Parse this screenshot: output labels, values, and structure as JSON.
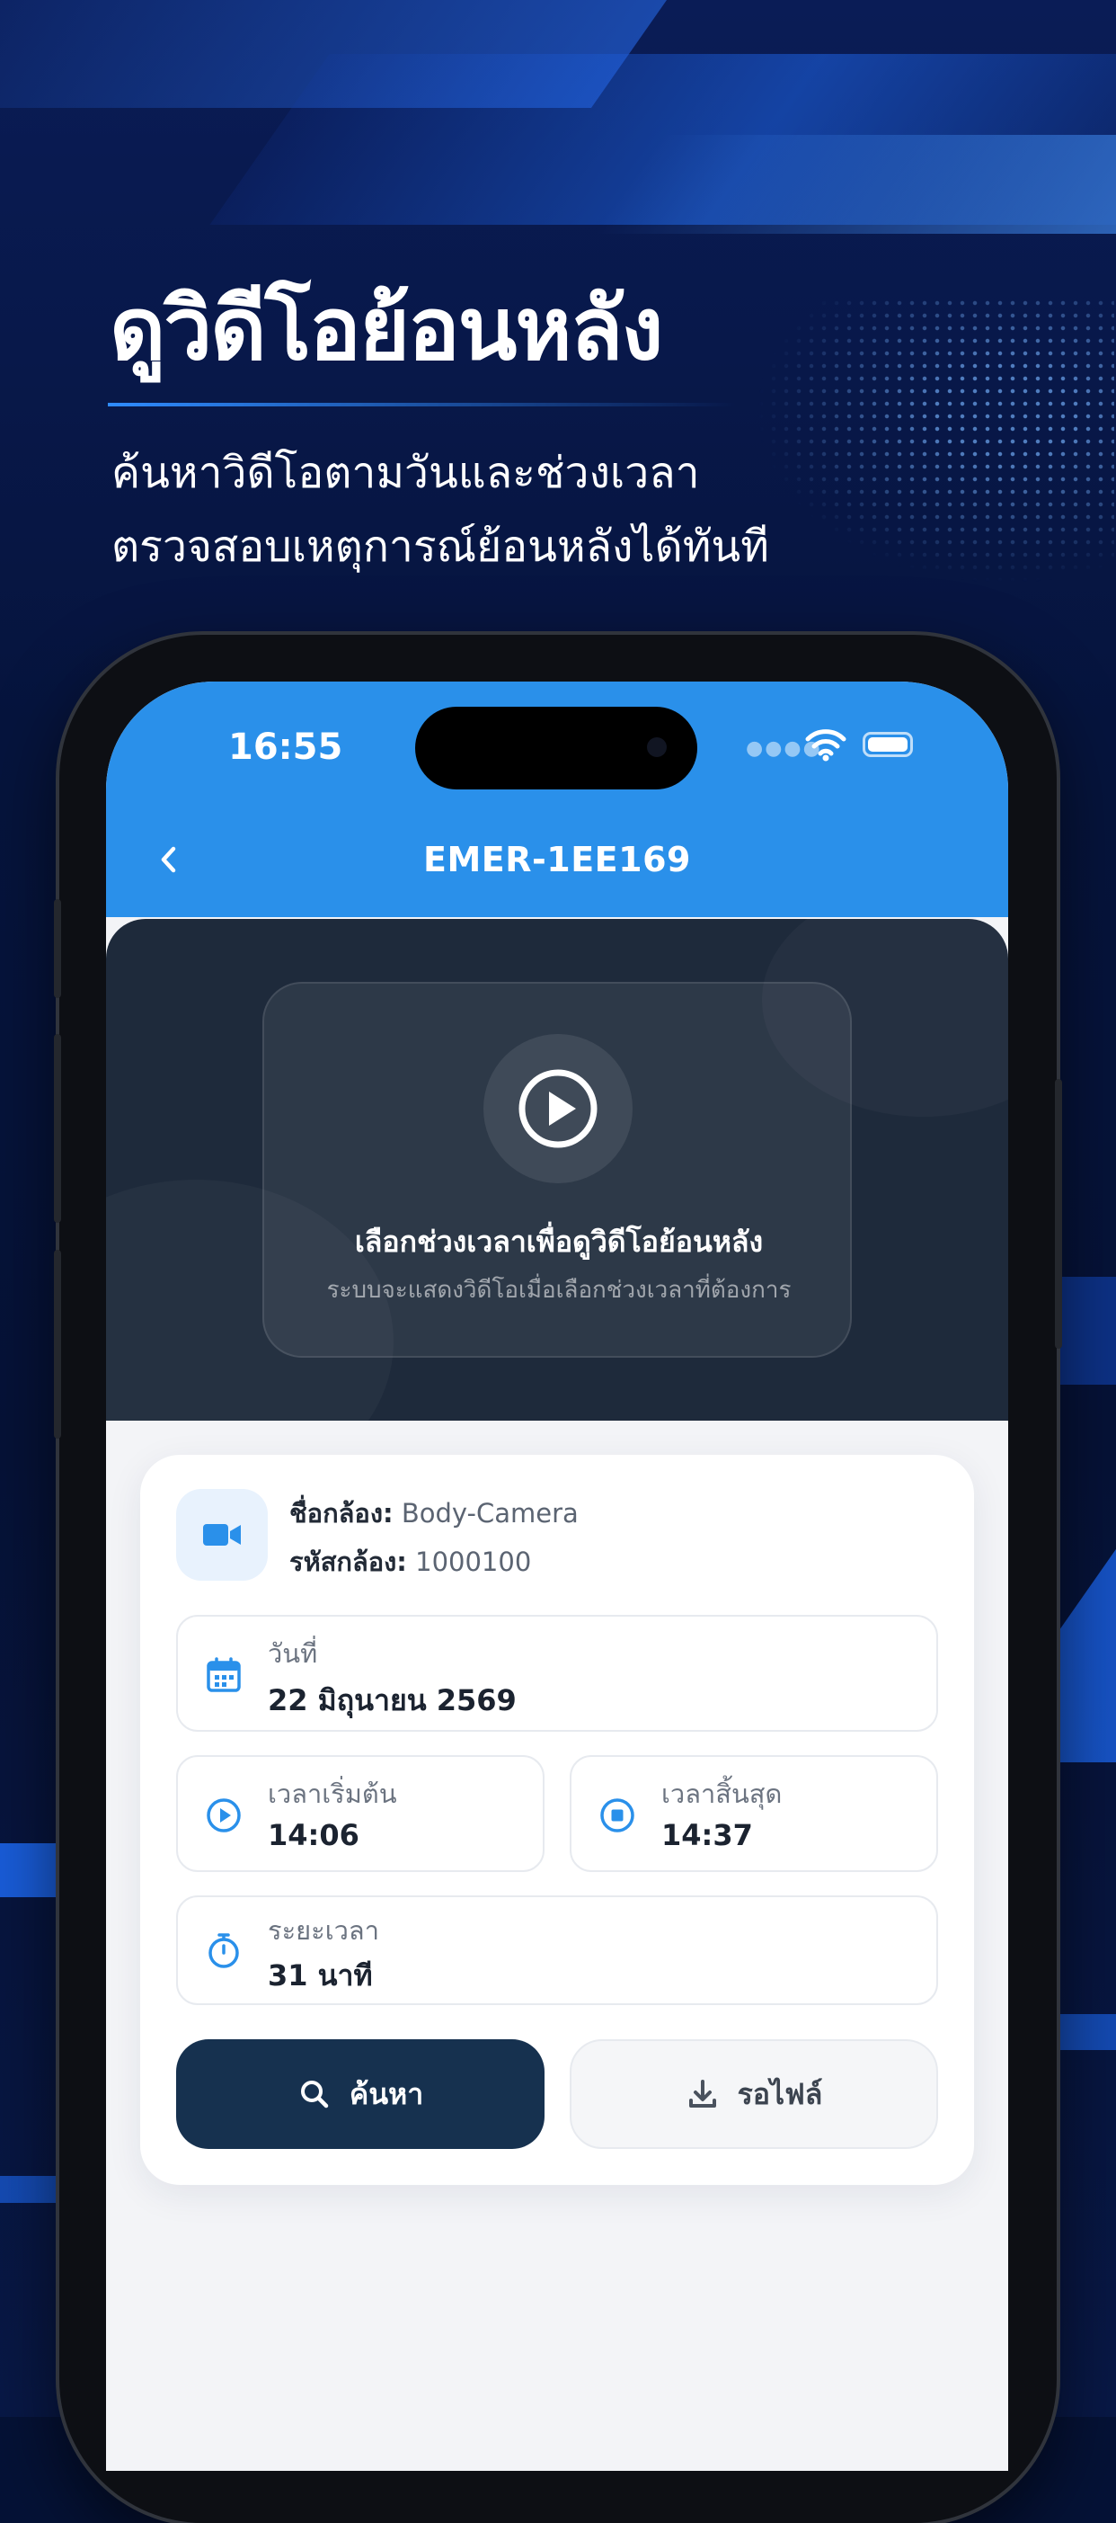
{
  "promo": {
    "headline": "ดูวิดีโอย้อนหลัง",
    "subline_1": "ค้นหาวิดีโอตามวันและช่วงเวลา",
    "subline_2": "ตรวจสอบเหตุการณ์ย้อนหลังได้ทันที"
  },
  "status_bar": {
    "time": "16:55"
  },
  "nav": {
    "title": "EMER-1EE169",
    "back_icon": "chevron-left-icon"
  },
  "player": {
    "play_icon": "play-circle-icon",
    "title": "เลือกช่วงเวลาเพื่อดูวิดีโอย้อนหลัง",
    "subtitle": "ระบบจะแสดงวิดีโอเมื่อเลือกช่วงเวลาที่ต้องการ"
  },
  "camera": {
    "icon": "video-camera-icon",
    "name_label": "ชื่อกล้อง:",
    "name_value": "Body-Camera",
    "id_label": "รหัสกล้อง:",
    "id_value": "1000100"
  },
  "fields": {
    "date": {
      "icon": "calendar-icon",
      "label": "วันที่",
      "value": "22 มิถุนายน 2569"
    },
    "start": {
      "icon": "play-circle-icon",
      "label": "เวลาเริ่มต้น",
      "value": "14:06"
    },
    "end": {
      "icon": "stop-circle-icon",
      "label": "เวลาสิ้นสุด",
      "value": "14:37"
    },
    "duration": {
      "icon": "stopwatch-icon",
      "label": "ระยะเวลา",
      "value": "31 นาที"
    }
  },
  "actions": {
    "search_label": "ค้นหา",
    "search_icon": "search-icon",
    "wait_label": "รอไฟล์",
    "wait_icon": "download-icon"
  },
  "colors": {
    "accent": "#2a90ea",
    "primary_button": "#16314f",
    "player_bg": "#1e2a3b",
    "icon_blue": "#2a90ea"
  }
}
